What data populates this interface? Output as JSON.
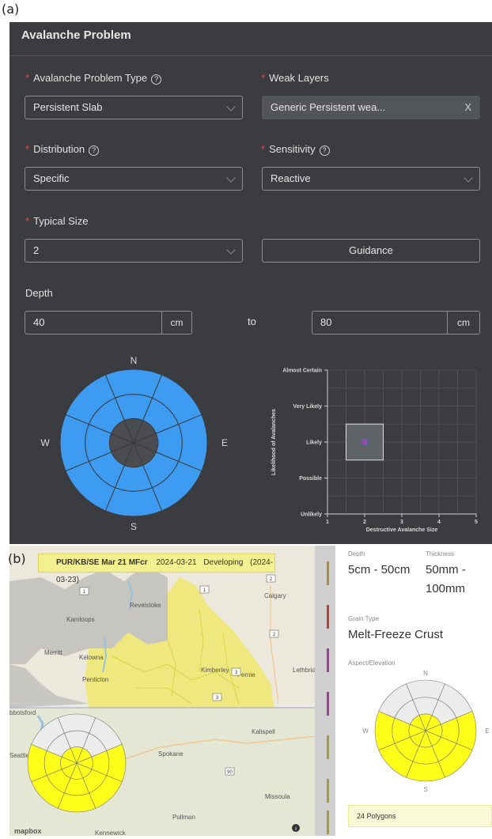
{
  "labels": {
    "a": "(a)",
    "b": "(b)"
  },
  "panel_a": {
    "title": "Avalanche Problem",
    "problem_type": {
      "label": "Avalanche Problem Type",
      "help": "?",
      "value": "Persistent Slab"
    },
    "weak_layers": {
      "label": "Weak Layers",
      "value": "Generic Persistent wea...",
      "clear": "X"
    },
    "distribution": {
      "label": "Distribution",
      "help": "?",
      "value": "Specific"
    },
    "sensitivity": {
      "label": "Sensitivity",
      "help": "?",
      "value": "Reactive"
    },
    "typical_size": {
      "label": "Typical Size",
      "value": "2"
    },
    "guidance_label": "Guidance",
    "depth": {
      "label": "Depth",
      "from": "40",
      "from_unit": "cm",
      "to_word": "to",
      "to": "80",
      "to_unit": "cm"
    },
    "compass": {
      "n": "N",
      "e": "E",
      "s": "S",
      "w": "W"
    },
    "colors": {
      "rose_fill": "#3d9bf2",
      "rose_center": "#4a4c50",
      "panel_bg": "#3a3c3f"
    }
  },
  "chart_data": {
    "type": "scatter",
    "title": "",
    "xlabel": "Destructive Avalanche Size",
    "ylabel": "Likelihood of Avalanches",
    "x_ticks": [
      "1",
      "2",
      "3",
      "4",
      "5"
    ],
    "y_ticks": [
      "Unlikely",
      "Possible",
      "Likely",
      "Very Likely",
      "Almost Certain"
    ],
    "xlim": [
      1,
      5
    ],
    "ylim": [
      1,
      5
    ],
    "box": {
      "x": [
        1.5,
        2.5
      ],
      "y": [
        2.5,
        3.5
      ]
    },
    "point": {
      "x": 2,
      "y": 3
    }
  },
  "panel_b": {
    "title": {
      "name": "PUR/KB/SE Mar 21 MFcr",
      "date": "2024-03-21",
      "status": "Developing",
      "date2": "(2024-03-23)"
    },
    "map_labels": [
      "Revelstoke",
      "Calgary",
      "Kamloops",
      "Merritt",
      "Kelowna",
      "Penticton",
      "Kimberley",
      "Fernie",
      "Lethbrid",
      "bbotsford",
      "Seattle",
      "Spokane",
      "Kalispell",
      "Missoula",
      "Pullman",
      "Kennewick"
    ],
    "road_shields": [
      "2",
      "1",
      "1",
      "2",
      "3",
      "3",
      "90"
    ],
    "mapbox": "mapbox",
    "info_icon": "i",
    "strip_colors": [
      "#b08a3c",
      "#b8432e",
      "#a13d9a",
      "#a13d9a",
      "#a89a3a",
      "#a89a3a",
      "#a89a3a",
      "#a89a3a"
    ],
    "right": {
      "depth_label": "Depth",
      "depth_value": "5cm - 50cm",
      "thickness_label": "Thickness",
      "thickness_value_1": "50mm -",
      "thickness_value_2": "100mm",
      "grain_label": "Grain Type",
      "grain_value": "Melt-Freeze Crust",
      "aspect_label": "Aspect/Elevation",
      "compass": {
        "n": "N",
        "e": "E",
        "s": "S",
        "w": "W"
      },
      "polygons": "24 Polygons"
    },
    "colors": {
      "rose_yellow": "#ffff1a",
      "rose_gray": "#ececec",
      "region_yellow": "#f0e860"
    }
  }
}
